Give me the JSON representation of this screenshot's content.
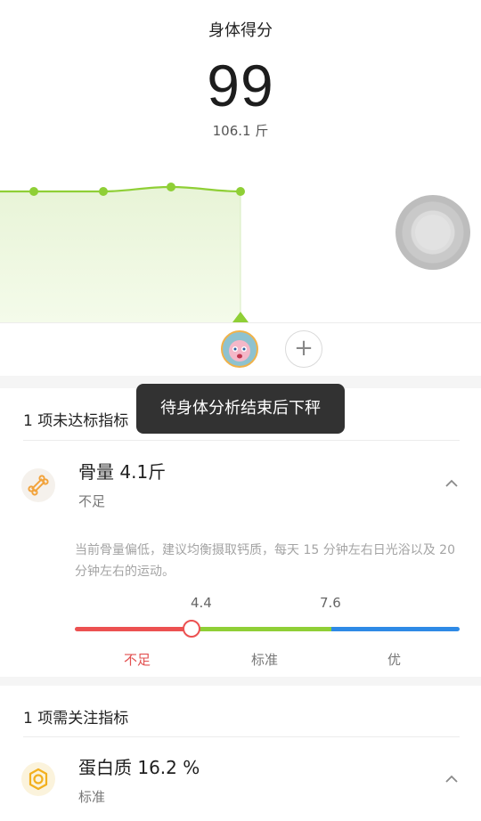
{
  "header": {
    "title": "身体得分",
    "score": "99",
    "weight": "106.1 斤"
  },
  "trend": {
    "line_color": "#8fcf36",
    "points": [
      100,
      100,
      101,
      99
    ]
  },
  "toast": {
    "text": "待身体分析结束后下秤"
  },
  "controls": {
    "add_label": "+"
  },
  "section_unmet": {
    "title": "1 项未达标指标",
    "item": {
      "icon": "bone-icon",
      "name": "骨量 4.1斤",
      "status": "不足",
      "advice": "当前骨量偏低，建议均衡摄取钙质，每天 15 分钟左右日光浴以及 20 分钟左右的运动。",
      "thresholds": [
        "4.4",
        "7.6"
      ],
      "levels": [
        "不足",
        "标准",
        "优"
      ],
      "level_colors": [
        "#ec5151",
        "#8fcf36",
        "#2e8ae6"
      ]
    }
  },
  "section_attention": {
    "title": "1 项需关注指标",
    "item": {
      "icon": "protein-icon",
      "name": "蛋白质 16.2 %",
      "status": "标准"
    }
  }
}
